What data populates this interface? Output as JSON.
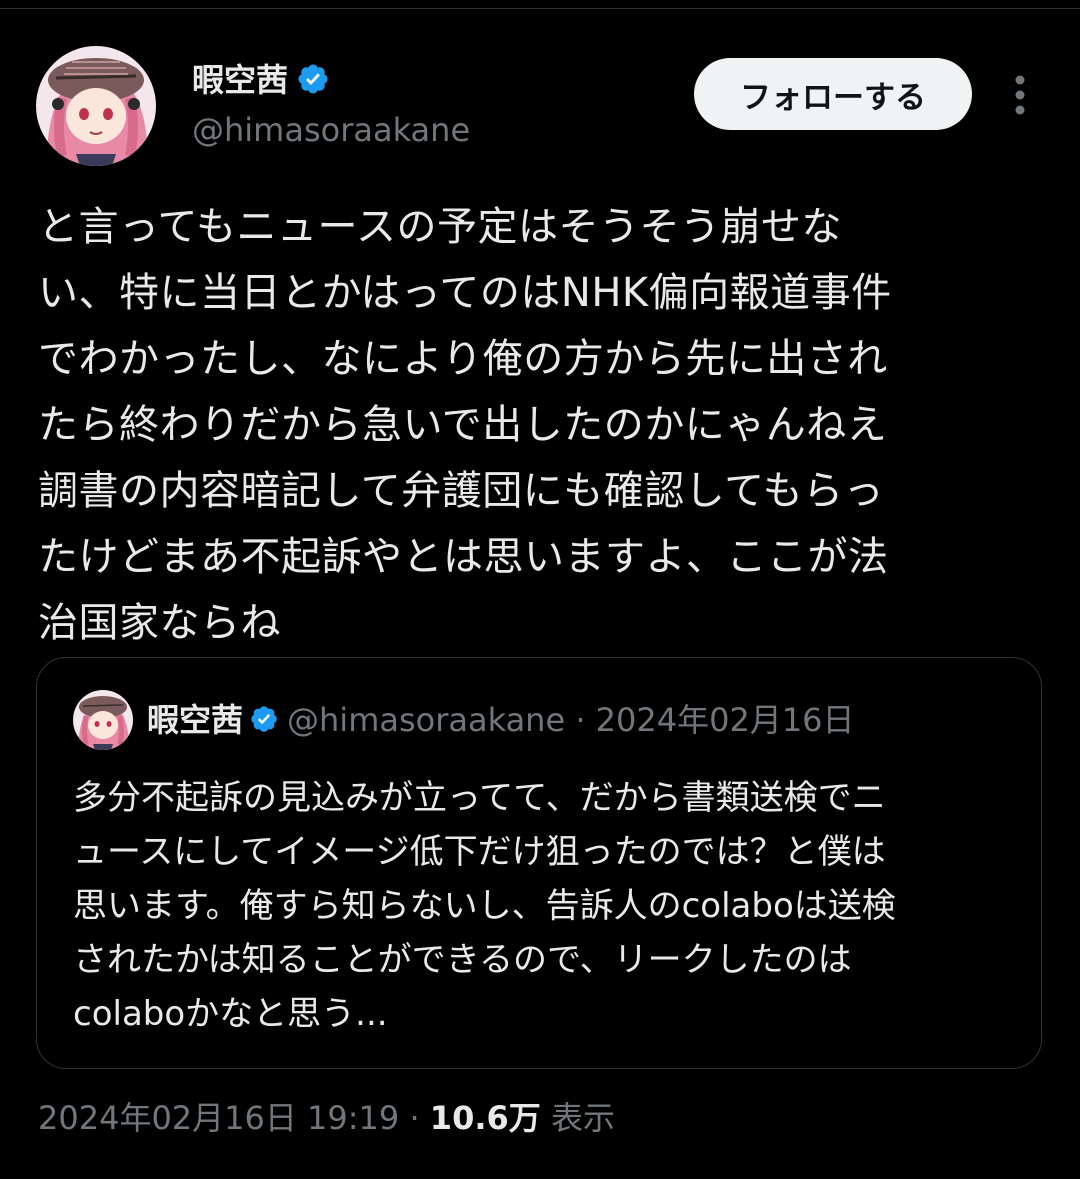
{
  "author": {
    "display_name": "暇空茜",
    "handle": "@himasoraakane"
  },
  "follow_button": {
    "label": "フォローする"
  },
  "tweet": {
    "text": "と言ってもニュースの予定はそうそう崩せな\nい、特に当日とかはってのはNHK偏向報道事件\nでわかったし、なにより俺の方から先に出され\nたら終わりだから急いで出したのかにゃんねえ\n調書の内容暗記して弁護団にも確認してもらっ\nたけどまあ不起訴やとは思いますよ、ここが法\n治国家ならね"
  },
  "quote_tweet": {
    "display_name": "暇空茜",
    "handle": "@himasoraakane",
    "separator": "·",
    "date": "2024年02月16日",
    "text": "多分不起訴の見込みが立ってて、だから書類送検でニ\nュースにしてイメージ低下だけ狙ったのでは？と僕は\n思います。俺すら知らないし、告訴人のcolaboは送検\nされたかは知ることができるので、リークしたのは\ncolaboかなと思う..."
  },
  "meta": {
    "timestamp": "2024年02月16日 19:19",
    "separator": "·",
    "views_count": "10.6万",
    "views_label": "表示"
  },
  "colors": {
    "background": "#000000",
    "text_primary": "#e7e9ea",
    "text_secondary": "#71767b",
    "verified_blue": "#1d9bf0",
    "border": "#2f3336",
    "follow_button_bg": "#eff3f4"
  },
  "icons": {
    "verified": "verified-badge-icon",
    "more": "more-options-icon"
  }
}
